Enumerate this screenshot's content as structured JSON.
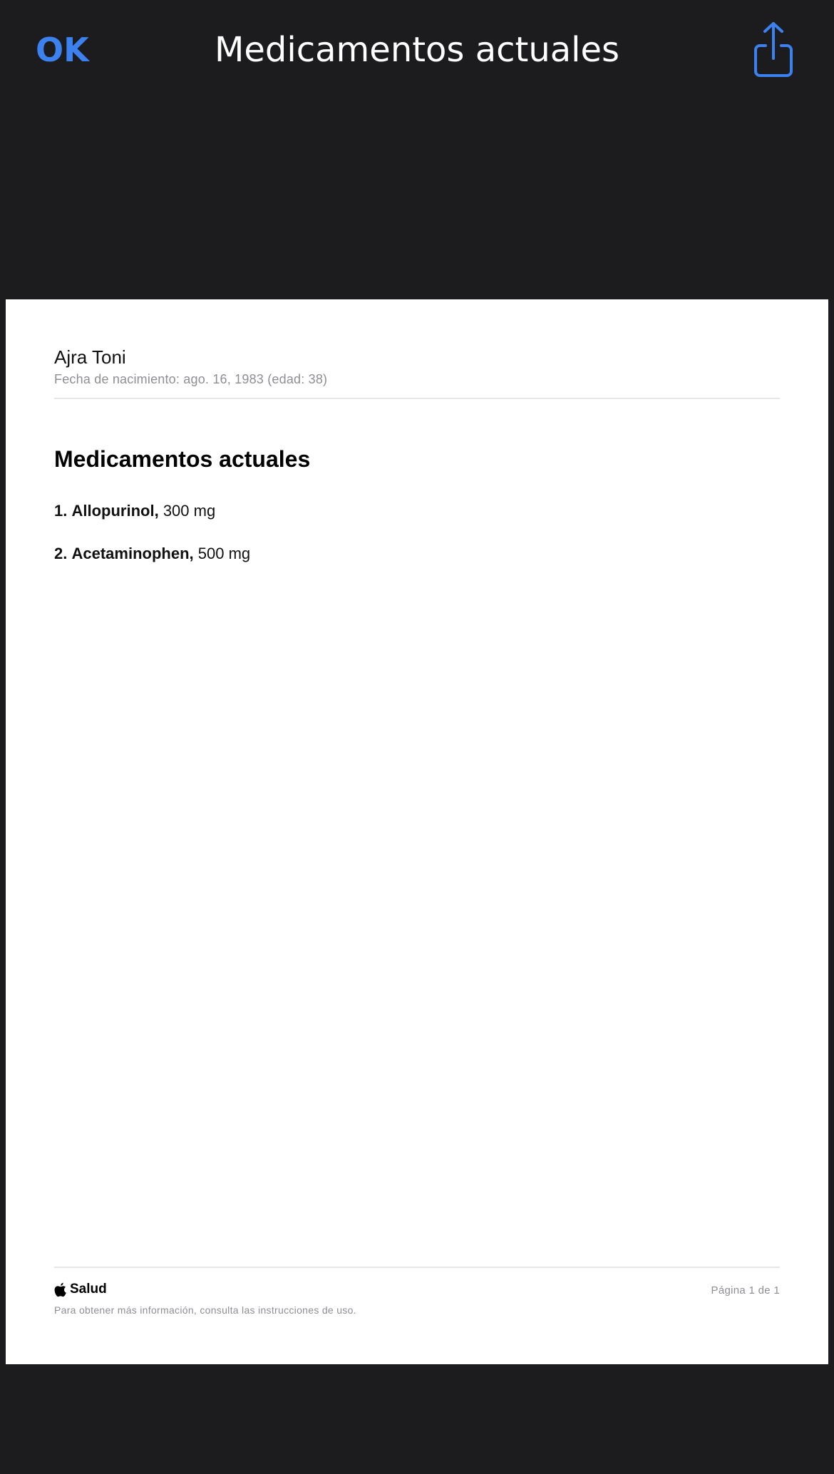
{
  "nav": {
    "done_label": "OK",
    "title": "Medicamentos actuales",
    "share_icon": "share-icon"
  },
  "document": {
    "patient_name": "Ajra Toni",
    "patient_dob": "Fecha de nacimiento: ago. 16, 1983 (edad: 38)",
    "section_title": "Medicamentos actuales",
    "medications": [
      {
        "number": "1.",
        "name": "Allopurinol,",
        "dose": "300 mg"
      },
      {
        "number": "2.",
        "name": "Acetaminophen,",
        "dose": "500 mg"
      }
    ],
    "footer": {
      "brand_icon": "apple-logo-icon",
      "brand_name": "Salud",
      "page_number": "Página 1 de 1",
      "note": "Para obtener más información, consulta las instrucciones de uso."
    }
  },
  "colors": {
    "background": "#1c1c1e",
    "accent": "#3b82f0",
    "document": "#ffffff",
    "secondary_text": "#8e8e93"
  }
}
